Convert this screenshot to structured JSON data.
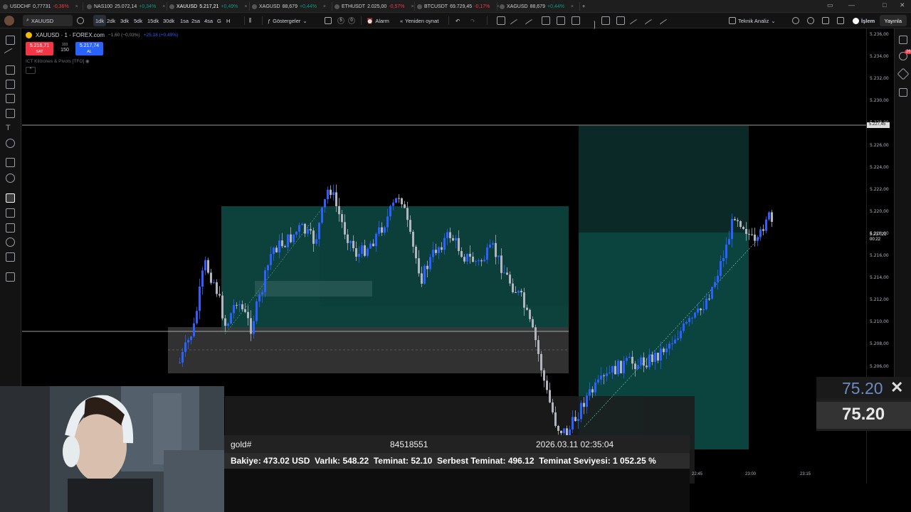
{
  "browser_tabs": [
    {
      "symbol": "USDCHF",
      "price": "0,77731",
      "change": "-0,36%",
      "up": false
    },
    {
      "symbol": "NAS100",
      "price": "25.072,14",
      "change": "+0,34%",
      "up": true
    },
    {
      "symbol": "XAUUSD",
      "price": "5.217,21",
      "change": "+0,49%",
      "up": true,
      "active": true
    },
    {
      "symbol": "XAGUSD",
      "price": "88,679",
      "change": "+0,44%",
      "up": true
    },
    {
      "symbol": "ETHUSDT",
      "price": "2.025,00",
      "change": "-0,57%",
      "up": false
    },
    {
      "symbol": "BTCUSDT",
      "price": "69.729,45",
      "change": "-0,17%",
      "up": false
    },
    {
      "symbol": "XAGUSD",
      "price": "88,679",
      "change": "+0,44%",
      "up": true
    }
  ],
  "toolbar": {
    "symbol": "XAUUSD",
    "timeframes": [
      "1dk",
      "2dk",
      "3dk",
      "5dk",
      "15dk",
      "30dk",
      "1sa",
      "2sa",
      "4sa",
      "G",
      "H"
    ],
    "active_timeframe": "1dk",
    "indicators_label": "Göstergeler",
    "alarm_label": "Alarm",
    "replay_label": "Yeniden oynat",
    "counter_a": "5",
    "counter_b": "0",
    "layout_label": "Teknik Analiz",
    "trade_label": "İşlem",
    "publish_label": "Yayınla"
  },
  "symbol_info": {
    "title": "XAUUSD · 1 · FOREX.com",
    "change_abs": "−1,60 (−0,03%)",
    "change_day": "+25,18 (+0,49%)",
    "sell_price": "5.216,71",
    "sell_label": "SAT",
    "buy_price": "5.217,74",
    "buy_label": "AL",
    "spread_top": "103",
    "spread_val": "150",
    "indicator_name": "ICT Killzones & Pivots [TFO]"
  },
  "price_axis": {
    "ticks": [
      "5.236,00",
      "5.234,00",
      "5.232,00",
      "5.230,00",
      "5.228,00",
      "5.226,00",
      "5.224,00",
      "5.222,00",
      "5.220,00",
      "5.218,00",
      "5.216,00",
      "5.214,00",
      "5.212,00",
      "5.210,00",
      "5.208,00",
      "5.206,00"
    ],
    "highlight_price": "5.227,45",
    "last_price": "5.217,21",
    "countdown": "00:22"
  },
  "time_axis": {
    "ticks": [
      "22:45",
      "23:00",
      "23:15"
    ]
  },
  "right_badge": "26",
  "account_panel": {
    "symbol": "gold#",
    "ticket": "84518551",
    "time": "2026.03.11 02:35:04",
    "balance_label": "Bakiye:",
    "balance": "473.02 USD",
    "equity_label": "Varlık:",
    "equity": "548.22",
    "margin_label": "Teminat:",
    "margin": "52.10",
    "free_margin_label": "Serbest Teminat:",
    "free_margin": "496.12",
    "margin_level_label": "Teminat Seviyesi:",
    "margin_level": "1 052.25 %"
  },
  "overlay": {
    "value_top": "75.20",
    "value_bottom": "75.20"
  },
  "colors": {
    "bull": "#2962ff",
    "bear": "#b2b5be",
    "zone_green": "#0f5a54",
    "zone_gray": "#3a3a3a"
  }
}
